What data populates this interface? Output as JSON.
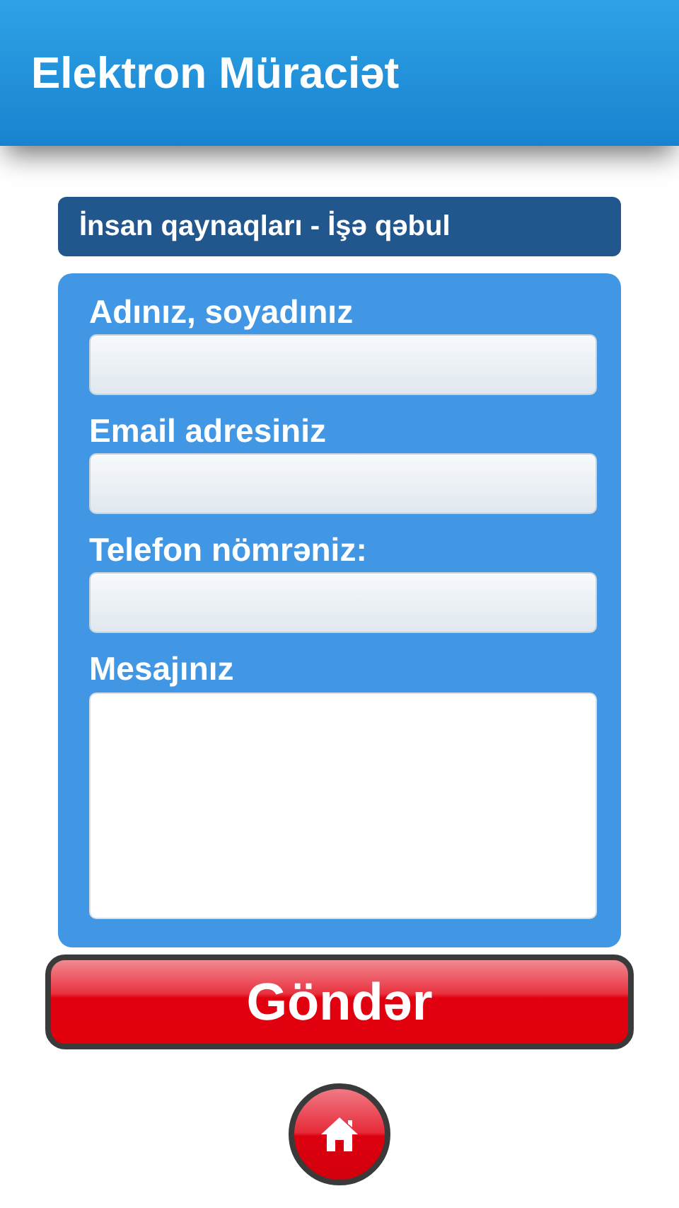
{
  "header": {
    "title": "Elektron Müraciət"
  },
  "category": {
    "label": "İnsan qaynaqları - İşə qəbul"
  },
  "fields": [
    {
      "label": "Adınız, soyadınız",
      "kind": "input"
    },
    {
      "label": "Email adresiniz",
      "kind": "input"
    },
    {
      "label": "Telefon nömrəniz:",
      "kind": "input"
    },
    {
      "label": "Mesajınız",
      "kind": "textarea"
    }
  ],
  "submit": {
    "label": "Göndər"
  }
}
